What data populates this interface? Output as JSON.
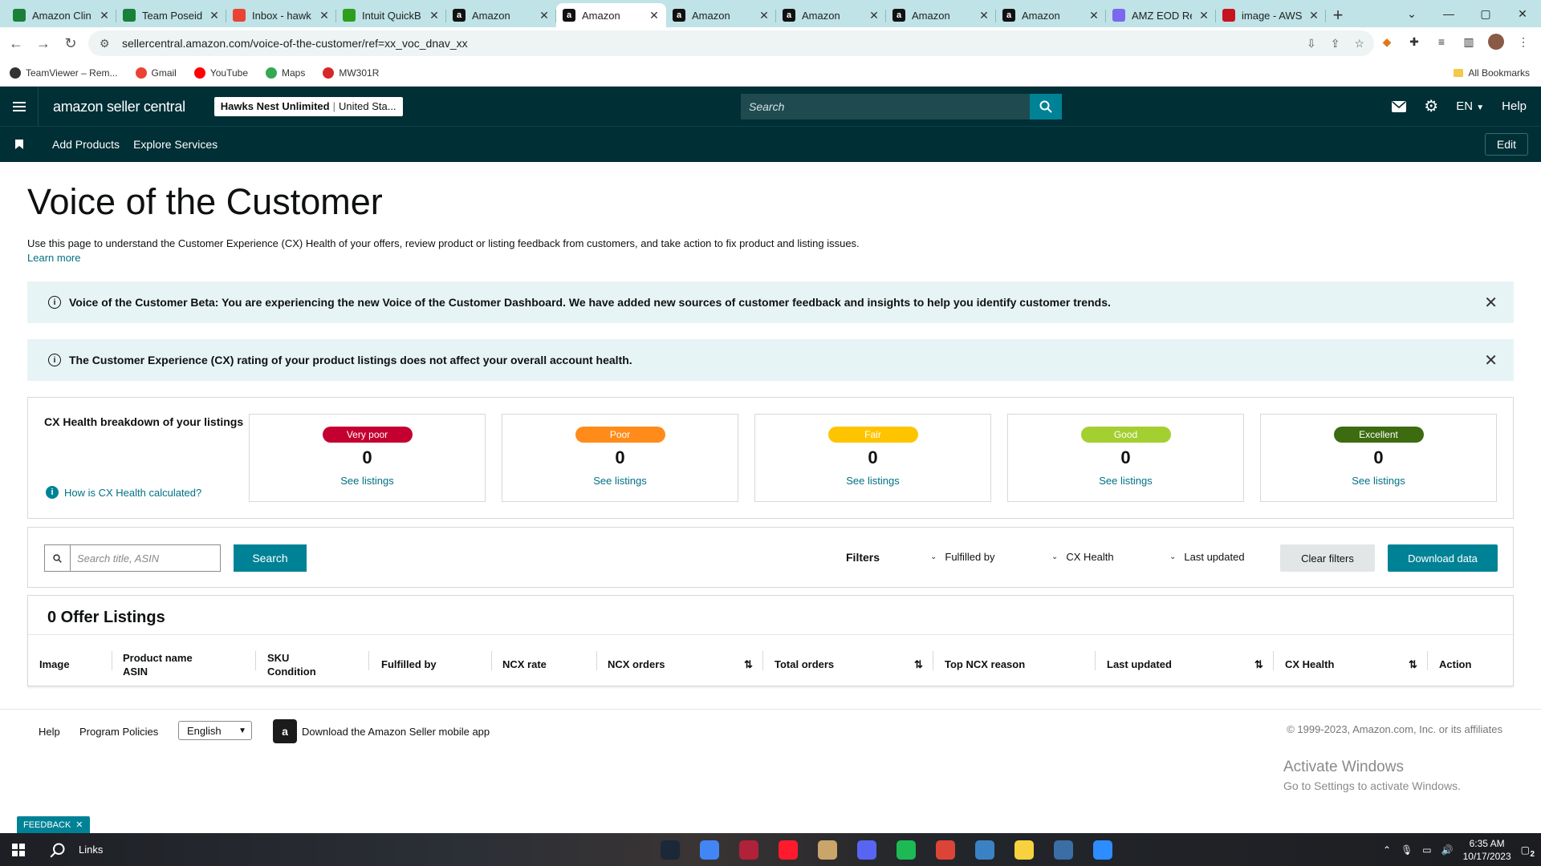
{
  "browser": {
    "tabs": [
      {
        "label": "Amazon Clin",
        "icon": "sheets-icon",
        "color": "#188038"
      },
      {
        "label": "Team Poseido",
        "icon": "sheets-icon",
        "color": "#188038"
      },
      {
        "label": "Inbox - hawk",
        "icon": "gmail-icon",
        "color": "#ea4335"
      },
      {
        "label": "Intuit QuickB",
        "icon": "quickbooks-icon",
        "color": "#2ca01c"
      },
      {
        "label": "Amazon",
        "icon": "amazon-icon",
        "color": "#111111"
      },
      {
        "label": "Amazon",
        "icon": "amazon-icon",
        "color": "#111111",
        "active": true
      },
      {
        "label": "Amazon",
        "icon": "amazon-icon",
        "color": "#111111"
      },
      {
        "label": "Amazon",
        "icon": "amazon-icon",
        "color": "#111111"
      },
      {
        "label": "Amazon",
        "icon": "amazon-icon",
        "color": "#111111"
      },
      {
        "label": "Amazon",
        "icon": "amazon-icon",
        "color": "#111111"
      },
      {
        "label": "AMZ EOD Re",
        "icon": "clickup-icon",
        "color": "#7b68ee"
      },
      {
        "label": "image - AWS",
        "icon": "aws-icon",
        "color": "#c7131f"
      }
    ],
    "url": "sellercentral.amazon.com/voice-of-the-customer/ref=xx_voc_dnav_xx",
    "bookmarks": [
      {
        "label": "TeamViewer – Rem...",
        "color": "#333333"
      },
      {
        "label": "Gmail",
        "color": "#ea4335"
      },
      {
        "label": "YouTube",
        "color": "#ff0000"
      },
      {
        "label": "Maps",
        "color": "#34a853"
      },
      {
        "label": "MW301R",
        "color": "#d62828"
      }
    ],
    "all_bookmarks": "All Bookmarks"
  },
  "header": {
    "logo": "amazon seller central",
    "store_name": "Hawks Nest Unlimited",
    "store_region": "United Sta...",
    "search_placeholder": "Search",
    "language": "EN",
    "help": "Help"
  },
  "subnav": {
    "items": [
      "Add Products",
      "Explore Services"
    ],
    "edit": "Edit"
  },
  "page": {
    "title": "Voice of the Customer",
    "intro": "Use this page to understand the Customer Experience (CX) Health of your offers, review product or listing feedback from customers, and take action to fix product and listing issues.",
    "learn_more": "Learn more"
  },
  "banners": {
    "beta": "Voice of the Customer Beta: You are experiencing the new Voice of the Customer Dashboard. We have added new sources of customer feedback and insights to help you identify customer trends.",
    "cx_note": "The Customer Experience (CX) rating of your product listings does not affect your overall account health."
  },
  "cx_health": {
    "label": "CX Health breakdown of your listings",
    "how_link": "How is CX Health calculated?",
    "cards": [
      {
        "label": "Very poor",
        "count": "0",
        "link": "See listings",
        "color": "#c40031",
        "text_color": "#ffffff"
      },
      {
        "label": "Poor",
        "count": "0",
        "link": "See listings",
        "color": "#ff8c1a",
        "text_color": "#ffffff"
      },
      {
        "label": "Fair",
        "count": "0",
        "link": "See listings",
        "color": "#ffc400",
        "text_color": "#ffffff"
      },
      {
        "label": "Good",
        "count": "0",
        "link": "See listings",
        "color": "#a4cf30",
        "text_color": "#ffffff"
      },
      {
        "label": "Excellent",
        "count": "0",
        "link": "See listings",
        "color": "#3d6b0f",
        "text_color": "#ffffff"
      }
    ]
  },
  "filters": {
    "search_placeholder": "Search title, ASIN",
    "search_button": "Search",
    "label": "Filters",
    "fulfilled_by": "Fulfilled by",
    "cx_health": "CX Health",
    "last_updated": "Last updated",
    "clear": "Clear filters",
    "download": "Download data"
  },
  "listings": {
    "title": "0 Offer Listings",
    "columns": [
      {
        "line1": "Image",
        "line2": ""
      },
      {
        "line1": "Product name",
        "line2": "ASIN"
      },
      {
        "line1": "SKU",
        "line2": "Condition"
      },
      {
        "line1": "Fulfilled by",
        "line2": ""
      },
      {
        "line1": "NCX rate",
        "line2": ""
      },
      {
        "line1": "NCX orders",
        "line2": ""
      },
      {
        "line1": "Total orders",
        "line2": ""
      },
      {
        "line1": "Top NCX reason",
        "line2": ""
      },
      {
        "line1": "Last updated",
        "line2": ""
      },
      {
        "line1": "CX Health",
        "line2": ""
      },
      {
        "line1": "Action",
        "line2": ""
      }
    ]
  },
  "footer": {
    "help": "Help",
    "program_policies": "Program Policies",
    "language": "English",
    "app_download": "Download the Amazon Seller mobile app",
    "copyright": "© 1999-2023, Amazon.com, Inc. or its affiliates"
  },
  "watermark": {
    "line1": "Activate Windows",
    "line2": "Go to Settings to activate Windows."
  },
  "feedback": "FEEDBACK",
  "taskbar": {
    "search_label": "Links",
    "time": "6:35 AM",
    "date": "10/17/2023",
    "notifications": "2",
    "apps": [
      {
        "name": "steam-icon",
        "color": "#1b2838"
      },
      {
        "name": "chrome-icon",
        "color": "#4285f4"
      },
      {
        "name": "app-icon",
        "color": "#b0213a"
      },
      {
        "name": "opera-icon",
        "color": "#ff1b2d"
      },
      {
        "name": "photo-app-icon",
        "color": "#c9a56a"
      },
      {
        "name": "discord-icon",
        "color": "#5865f2"
      },
      {
        "name": "spotify-icon",
        "color": "#1db954"
      },
      {
        "name": "chrome-profile-icon",
        "color": "#db4437"
      },
      {
        "name": "notes-app-icon",
        "color": "#3b82c4"
      },
      {
        "name": "sticky-notes-icon",
        "color": "#f7d23e"
      },
      {
        "name": "calculator-icon",
        "color": "#3a6ea5"
      },
      {
        "name": "zoom-icon",
        "color": "#2d8cff"
      }
    ]
  }
}
